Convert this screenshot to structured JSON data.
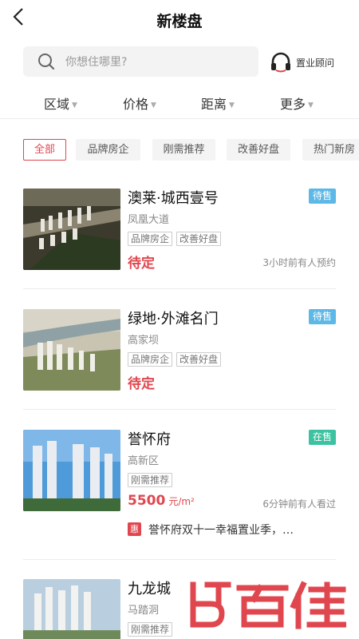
{
  "header": {
    "title": "新楼盘",
    "back_icon": "back-chevron-icon"
  },
  "search": {
    "placeholder": "你想住哪里?",
    "icon": "search-icon"
  },
  "advisor": {
    "label": "置业顾问",
    "icon": "headset-icon"
  },
  "filters": [
    {
      "label": "区域"
    },
    {
      "label": "价格"
    },
    {
      "label": "距离"
    },
    {
      "label": "更多"
    }
  ],
  "chips": [
    {
      "label": "全部",
      "active": true
    },
    {
      "label": "品牌房企",
      "active": false
    },
    {
      "label": "刚需推荐",
      "active": false
    },
    {
      "label": "改善好盘",
      "active": false
    },
    {
      "label": "热门新房",
      "active": false
    }
  ],
  "listings": [
    {
      "name": "澳莱·城西壹号",
      "area": "凤凰大道",
      "tags": [
        "品牌房企",
        "改善好盘"
      ],
      "status": "待售",
      "status_color": "#5cb8e6",
      "price": "待定",
      "price_unit": "",
      "note": "3小时前有人预约"
    },
    {
      "name": "绿地·外滩名门",
      "area": "高家坝",
      "tags": [
        "品牌房企",
        "改善好盘"
      ],
      "status": "待售",
      "status_color": "#5cb8e6",
      "price": "待定",
      "price_unit": "",
      "note": ""
    },
    {
      "name": "誉怀府",
      "area": "高新区",
      "tags": [
        "刚需推荐"
      ],
      "status": "在售",
      "status_color": "#3cc2a0",
      "price": "5500",
      "price_unit": "元/m²",
      "note": "6分钟前有人看过",
      "promo_badge": "惠",
      "promo_text": "誉怀府双十一幸福置业季，…"
    },
    {
      "name": "九龙城",
      "area": "马踏洞",
      "tags": [
        "刚需推荐"
      ],
      "status": "",
      "price": "",
      "note": ""
    }
  ],
  "watermark": {
    "text": "百佳",
    "brand_color": "#e0464e"
  }
}
